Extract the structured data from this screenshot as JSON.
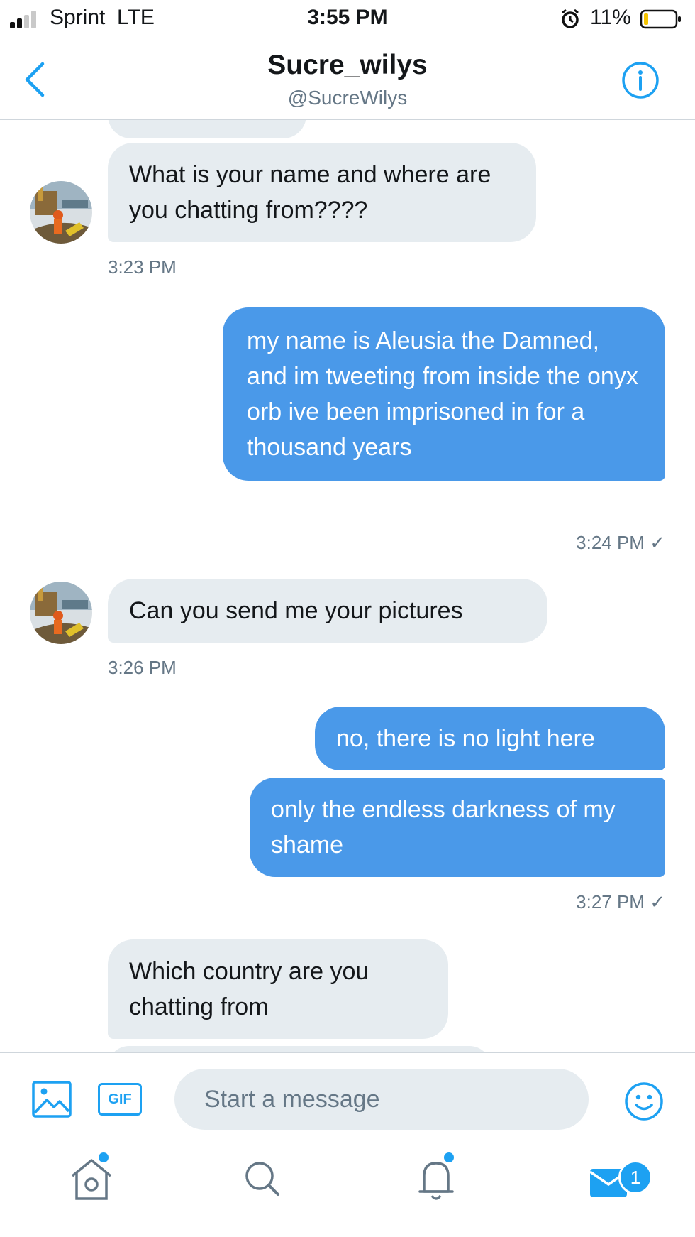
{
  "status_bar": {
    "carrier": "Sprint  LTE",
    "time": "3:55 PM",
    "battery": "11%"
  },
  "header": {
    "title": "Sucre_wilys",
    "handle": "@SucreWilys"
  },
  "messages": [
    {
      "from": "them",
      "text": "What is your name and where are you chatting from????",
      "time": "3:23 PM"
    },
    {
      "from": "me",
      "text": "my name is Aleusia the Damned, and im tweeting from inside the onyx orb ive been imprisoned in for a thousand years",
      "time": "3:24 PM",
      "read_mark": "✓"
    },
    {
      "from": "them",
      "text": "Can you send me your pictures",
      "time": "3:26 PM"
    },
    {
      "from": "me",
      "text": "no, there is no light here"
    },
    {
      "from": "me",
      "text": "only the endless darkness of my shame",
      "time": "3:27 PM",
      "read_mark": "✓"
    },
    {
      "from": "them",
      "text": "Which country are you chatting from"
    }
  ],
  "composer": {
    "gif_label": "GIF",
    "placeholder": "Start a message"
  },
  "tab_bar": {
    "messages_badge": "1"
  },
  "colors": {
    "accent": "#1da1f2",
    "outgoing_bubble": "#4a99e9",
    "incoming_bubble": "#e6ecf0",
    "secondary_text": "#657786"
  },
  "icons": {
    "back": "chevron-left-icon",
    "info": "info-icon",
    "photo": "image-icon",
    "emoji": "smiley-icon",
    "home": "home-icon",
    "search": "search-icon",
    "notifications": "bell-icon",
    "messages": "envelope-icon"
  }
}
